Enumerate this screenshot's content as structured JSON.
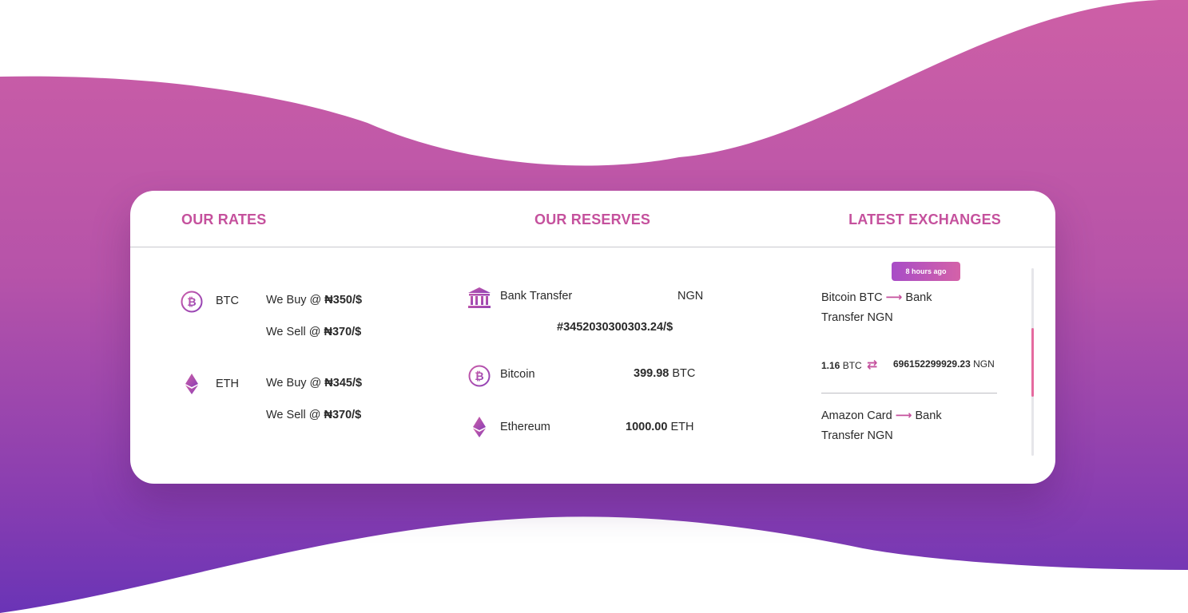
{
  "headers": {
    "rates": "OUR RATES",
    "reserves": "OUR RESERVES",
    "exchanges": "LATEST EXCHANGES"
  },
  "rates": [
    {
      "coin": "BTC",
      "icon": "bitcoin-icon",
      "buy_label": "We Buy @",
      "buy_value": "₦350/$",
      "sell_label": "We Sell @",
      "sell_value": "₦370/$"
    },
    {
      "coin": "ETH",
      "icon": "ethereum-icon",
      "buy_label": "We Buy @",
      "buy_value": "₦345/$",
      "sell_label": "We Sell @",
      "sell_value": "₦370/$"
    }
  ],
  "reserves": {
    "bank": {
      "icon": "bank-icon",
      "name": "Bank Transfer",
      "currency": "NGN",
      "amount": "#3452030300303.24/$"
    },
    "bitcoin": {
      "icon": "bitcoin-icon",
      "name": "Bitcoin",
      "amount": "399.98",
      "unit": "BTC"
    },
    "ethereum": {
      "icon": "ethereum-icon",
      "name": "Ethereum",
      "amount": "1000.00",
      "unit": "ETH"
    }
  },
  "exchanges": {
    "badge": "8 hours ago",
    "items": [
      {
        "from": "Bitcoin BTC",
        "to_line1": "Bank",
        "to_line2": "Transfer NGN",
        "send_amount": "1.16",
        "send_unit": "BTC",
        "receive_amount": "696152299929.23",
        "receive_unit": "NGN"
      },
      {
        "from": "Amazon Card",
        "to_line1": "Bank",
        "to_line2": "Transfer NGN"
      }
    ],
    "arrow_icon": "long-arrow-right-icon",
    "swap_icon": "swap-arrows-icon"
  },
  "colors": {
    "accent_pink": "#c5519d",
    "gradient_top": "#c85fa8",
    "gradient_bottom": "#6f36b4",
    "scroll_thumb": "#e56a9f"
  }
}
